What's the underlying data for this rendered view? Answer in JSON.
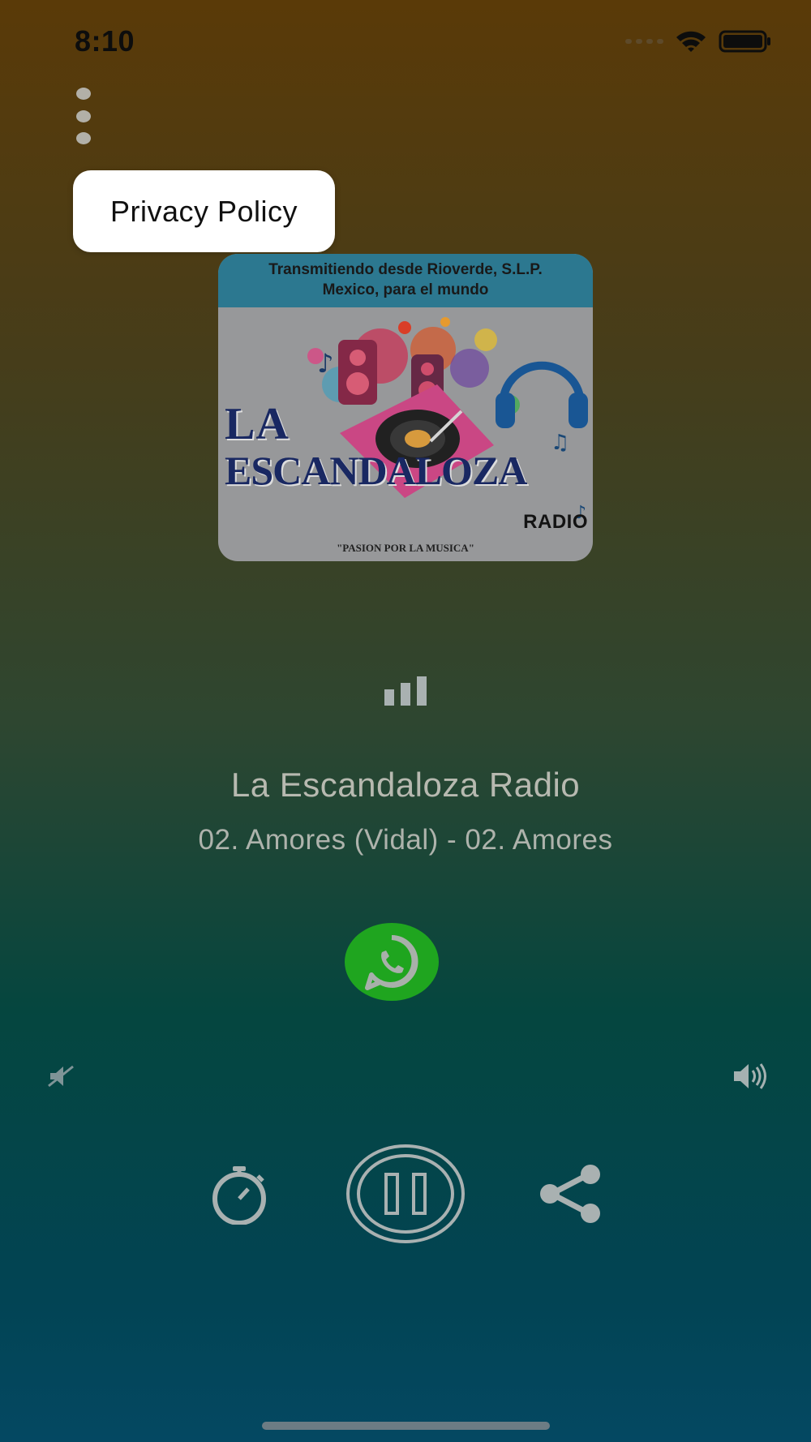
{
  "status_bar": {
    "time": "8:10"
  },
  "menu": {
    "icon": "more-vertical-icon",
    "popup_item": "Privacy Policy"
  },
  "logo": {
    "banner_line1": "Transmitiendo desde Rioverde, S.L.P.",
    "banner_line2": "Mexico, para el mundo",
    "word_la": "LA",
    "word_name": "ESCANDALOZA",
    "word_radio": "RADIO",
    "tagline": "\"PASION POR LA MUSICA\""
  },
  "now_playing": {
    "station": "La Escandaloza Radio",
    "track": "02. Amores (Vidal) - 02. Amores"
  },
  "colors": {
    "whatsapp_green": "#1fa51f",
    "icon_gray": "#a9b1b1",
    "popup_bg": "#ffffff"
  },
  "icons": {
    "equalizer": "equalizer-icon",
    "whatsapp": "whatsapp-icon",
    "volume_min": "volume-mute-icon",
    "volume_max": "volume-up-icon",
    "timer": "timer-icon",
    "pause": "pause-icon",
    "share": "share-icon"
  }
}
